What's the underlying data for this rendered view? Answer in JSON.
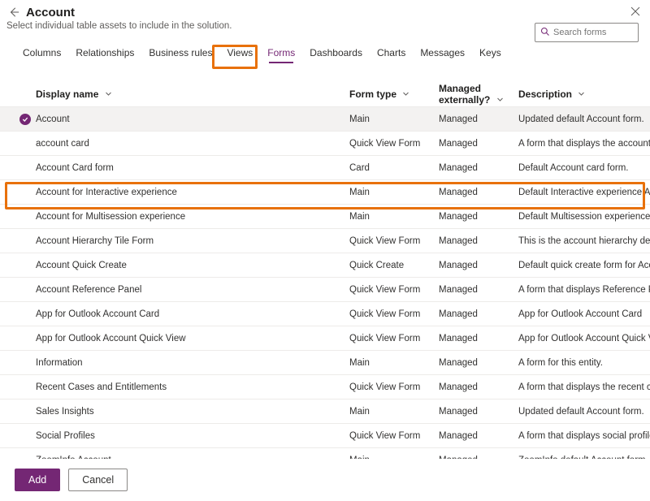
{
  "header": {
    "title": "Account",
    "subtitle": "Select individual table assets to include in the solution."
  },
  "search": {
    "placeholder": "Search forms"
  },
  "tabs": [
    {
      "label": "Columns",
      "id": "columns"
    },
    {
      "label": "Relationships",
      "id": "relationships"
    },
    {
      "label": "Business rules",
      "id": "business-rules"
    },
    {
      "label": "Views",
      "id": "views"
    },
    {
      "label": "Forms",
      "id": "forms",
      "active": true
    },
    {
      "label": "Dashboards",
      "id": "dashboards"
    },
    {
      "label": "Charts",
      "id": "charts"
    },
    {
      "label": "Messages",
      "id": "messages"
    },
    {
      "label": "Keys",
      "id": "keys"
    }
  ],
  "columns": {
    "display_name": "Display name",
    "form_type": "Form type",
    "managed": "Managed externally?",
    "description": "Description"
  },
  "rows": [
    {
      "selected": true,
      "name": "Account",
      "type": "Main",
      "managed": "Managed",
      "desc": "Updated default Account form."
    },
    {
      "selected": false,
      "name": "account card",
      "type": "Quick View Form",
      "managed": "Managed",
      "desc": "A form that displays the account card."
    },
    {
      "selected": false,
      "name": "Account Card form",
      "type": "Card",
      "managed": "Managed",
      "desc": "Default Account card form."
    },
    {
      "selected": false,
      "name": "Account for Interactive experience",
      "type": "Main",
      "managed": "Managed",
      "desc": "Default Interactive experience Account"
    },
    {
      "selected": false,
      "name": "Account for Multisession experience",
      "type": "Main",
      "managed": "Managed",
      "desc": "Default Multisession experience Accoun"
    },
    {
      "selected": false,
      "name": "Account Hierarchy Tile Form",
      "type": "Quick View Form",
      "managed": "Managed",
      "desc": "This is the account hierarchy definition."
    },
    {
      "selected": false,
      "name": "Account Quick Create",
      "type": "Quick Create",
      "managed": "Managed",
      "desc": "Default quick create form for Account"
    },
    {
      "selected": false,
      "name": "Account Reference Panel",
      "type": "Quick View Form",
      "managed": "Managed",
      "desc": "A form that displays Reference Panel of"
    },
    {
      "selected": false,
      "name": "App for Outlook Account Card",
      "type": "Quick View Form",
      "managed": "Managed",
      "desc": "App for Outlook Account Card"
    },
    {
      "selected": false,
      "name": "App for Outlook Account Quick View",
      "type": "Quick View Form",
      "managed": "Managed",
      "desc": "App for Outlook Account Quick View"
    },
    {
      "selected": false,
      "name": "Information",
      "type": "Main",
      "managed": "Managed",
      "desc": "A form for this entity."
    },
    {
      "selected": false,
      "name": "Recent Cases and Entitlements",
      "type": "Quick View Form",
      "managed": "Managed",
      "desc": "A form that displays the recent cases an"
    },
    {
      "selected": false,
      "name": "Sales Insights",
      "type": "Main",
      "managed": "Managed",
      "desc": "Updated default Account form."
    },
    {
      "selected": false,
      "name": "Social Profiles",
      "type": "Quick View Form",
      "managed": "Managed",
      "desc": "A form that displays social profiles of ac"
    },
    {
      "selected": false,
      "name": "ZoomInfo Account",
      "type": "Main",
      "managed": "Managed",
      "desc": "ZoomInfo default Account form."
    }
  ],
  "footer": {
    "add": "Add",
    "cancel": "Cancel"
  }
}
